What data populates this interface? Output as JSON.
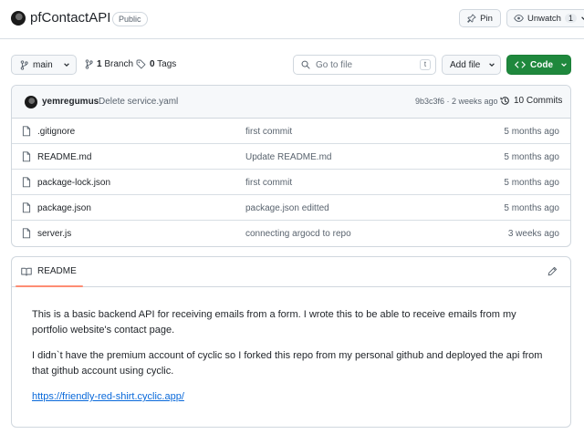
{
  "repo": {
    "name": "pfContactAPI",
    "visibility": "Public",
    "pin_label": "Pin",
    "watch_label": "Unwatch",
    "watch_count": "1"
  },
  "toolbar": {
    "branch": "main",
    "branches_count": "1",
    "branches_label": "Branch",
    "tags_count": "0",
    "tags_label": "Tags",
    "goto_placeholder": "Go to file",
    "goto_shortcut": "t",
    "add_file_label": "Add file",
    "code_label": "Code"
  },
  "latest_commit": {
    "author": "yemregumus",
    "message": "Delete service.yaml",
    "sha_time": "9b3c3f6 · 2 weeks ago",
    "commits_count": "10 Commits"
  },
  "files": [
    {
      "name": ".gitignore",
      "commit": "first commit",
      "age": "5 months ago"
    },
    {
      "name": "README.md",
      "commit": "Update README.md",
      "age": "5 months ago"
    },
    {
      "name": "package-lock.json",
      "commit": "first commit",
      "age": "5 months ago"
    },
    {
      "name": "package.json",
      "commit": "package.json editted",
      "age": "5 months ago"
    },
    {
      "name": "server.js",
      "commit": "connecting argocd to repo",
      "age": "3 weeks ago"
    }
  ],
  "readme": {
    "tab_label": "README",
    "paragraph_1": "This is a basic backend API for receiving emails from a form. I wrote this to be able to receive emails from my portfolio website's contact page.",
    "paragraph_2": "I didn`t have the premium account of cyclic so I forked this repo from my personal github and deployed the api from that github account using cyclic.",
    "link": "https://friendly-red-shirt.cyclic.app/"
  },
  "colors": {
    "code_button": "#1f883d",
    "link": "#0969da",
    "tab_underline": "#fd8c73"
  }
}
